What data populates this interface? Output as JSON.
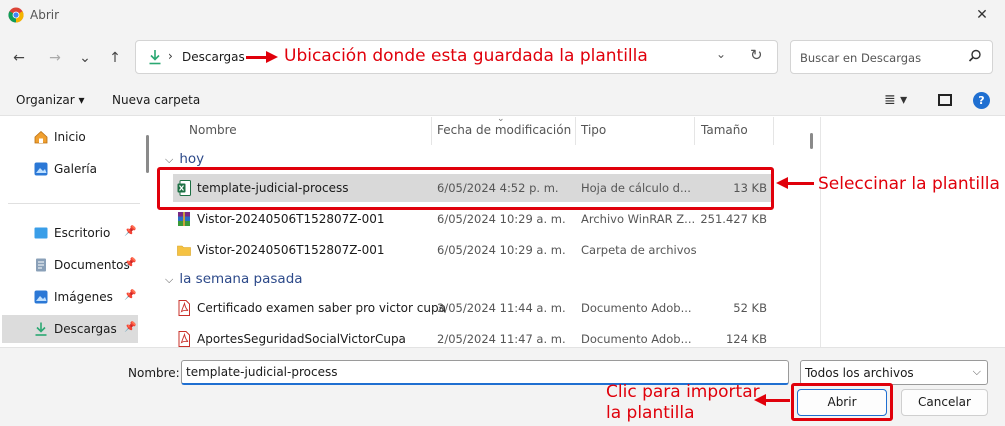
{
  "window": {
    "title": "Abrir",
    "close_glyph": "✕"
  },
  "nav": {
    "back_glyph": "←",
    "forward_glyph": "→",
    "recent_glyph": "⌄",
    "up_glyph": "↑",
    "breadcrumb": "Descargas",
    "refresh_glyph": "↻",
    "dropdown_glyph": "⌄",
    "search_placeholder": "Buscar en Descargas"
  },
  "toolbar": {
    "organize": "Organizar ▾",
    "new_folder": "Nueva carpeta",
    "view_glyph": "≣ ▾",
    "help": "?"
  },
  "sidebar": {
    "items": [
      {
        "label": "Inicio",
        "icon": "home-icon"
      },
      {
        "label": "Galería",
        "icon": "gallery-icon"
      },
      {
        "label": "Escritorio",
        "icon": "desktop-icon"
      },
      {
        "label": "Documentos",
        "icon": "documents-icon"
      },
      {
        "label": "Imágenes",
        "icon": "pictures-icon"
      },
      {
        "label": "Descargas",
        "icon": "download-icon"
      }
    ]
  },
  "columns": {
    "name": "Nombre",
    "date": "Fecha de modificación",
    "type": "Tipo",
    "size": "Tamaño"
  },
  "groups": [
    {
      "label": "hoy",
      "files": [
        {
          "name": "template-judicial-process",
          "date": "6/05/2024 4:52 p. m.",
          "type": "Hoja de cálculo d...",
          "size": "13 KB",
          "icon": "excel-icon"
        },
        {
          "name": "Vistor-20240506T152807Z-001",
          "date": "6/05/2024 10:29 a. m.",
          "type": "Archivo WinRAR Z...",
          "size": "251.427 KB",
          "icon": "winrar-icon"
        },
        {
          "name": "Vistor-20240506T152807Z-001",
          "date": "6/05/2024 10:29 a. m.",
          "type": "Carpeta de archivos",
          "size": "",
          "icon": "folder-icon"
        }
      ]
    },
    {
      "label": "la semana pasada",
      "files": [
        {
          "name": "Certificado examen saber pro victor cupa",
          "date": "3/05/2024 11:44 a. m.",
          "type": "Documento Adob...",
          "size": "52 KB",
          "icon": "pdf-icon"
        },
        {
          "name": "AportesSeguridadSocialVictorCupa",
          "date": "2/05/2024 11:47 a. m.",
          "type": "Documento Adob...",
          "size": "124 KB",
          "icon": "pdf-icon"
        }
      ]
    }
  ],
  "bottom": {
    "name_label": "Nombre:",
    "name_value": "template-judicial-process",
    "filter": "Todos los archivos",
    "open": "Abrir",
    "cancel": "Cancelar"
  },
  "annotations": {
    "location": "Ubicación donde esta guardada la plantilla",
    "select": "Seleccinar la plantilla",
    "import_line1": "Clic para importar",
    "import_line2": "la plantilla"
  },
  "colors": {
    "annotation": "#e0000b",
    "accent": "#1f6fd1"
  }
}
